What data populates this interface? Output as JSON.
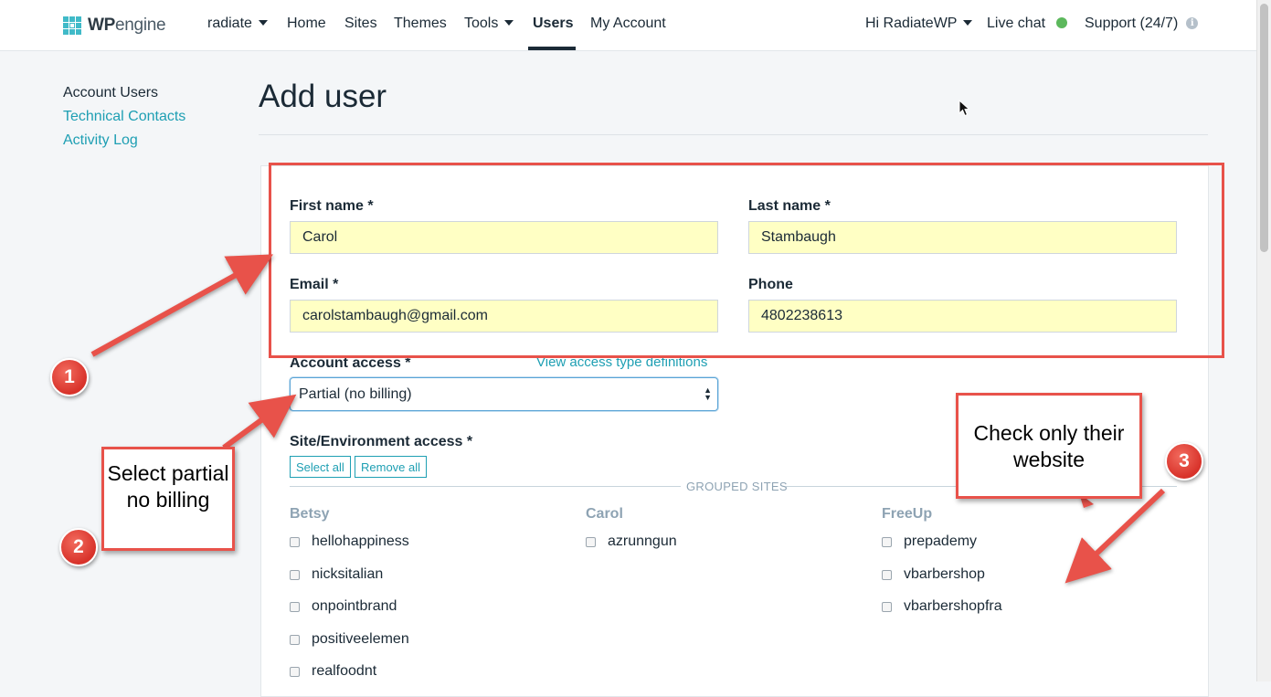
{
  "nav": {
    "brand_strong": "WP",
    "brand_rest": "engine",
    "account_dropdown": "radiate",
    "home": "Home",
    "sites": "Sites",
    "themes": "Themes",
    "tools": "Tools",
    "users": "Users",
    "my_account": "My Account",
    "greeting": "Hi RadiateWP",
    "live_chat": "Live chat",
    "support": "Support (24/7)",
    "live_status_color": "#5cb85c"
  },
  "sidebar": {
    "items": [
      {
        "label": "Account Users",
        "current": true
      },
      {
        "label": "Technical Contacts",
        "current": false
      },
      {
        "label": "Activity Log",
        "current": false
      }
    ]
  },
  "page": {
    "title": "Add user"
  },
  "form": {
    "first_name_label": "First name *",
    "first_name_value": "Carol",
    "last_name_label": "Last name *",
    "last_name_value": "Stambaugh",
    "email_label": "Email *",
    "email_value": "carolstambaugh@gmail.com",
    "phone_label": "Phone",
    "phone_value": "4802238613",
    "account_access_label": "Account access *",
    "access_definitions_link": "View access type definitions",
    "account_access_value": "Partial (no billing)",
    "site_access_label": "Site/Environment access *",
    "select_all": "Select all",
    "remove_all": "Remove all",
    "grouped_sites_label": "GROUPED SITES",
    "groups": [
      {
        "name": "Betsy",
        "sites": [
          "hellohappiness",
          "nicksitalian",
          "onpointbrand",
          "positiveelemen",
          "realfoodnt"
        ]
      },
      {
        "name": "Carol",
        "sites": [
          "azrunngun"
        ]
      },
      {
        "name": "FreeUp",
        "sites": [
          "prepademy",
          "vbarbershop",
          "vbarbershopfra"
        ]
      }
    ]
  },
  "annotations": {
    "callout_2": "Select partial no billing",
    "callout_3": "Check only their website",
    "badge_1": "1",
    "badge_2": "2",
    "badge_3": "3",
    "color": "#e8524a"
  },
  "icons": [
    "wpengine-logo-icon",
    "caret-down-icon",
    "live-status-dot-icon",
    "info-icon",
    "select-arrows-icon",
    "mouse-cursor-icon"
  ]
}
